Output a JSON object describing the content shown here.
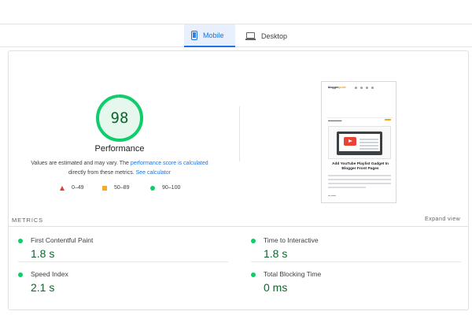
{
  "tabs": [
    {
      "label": "Mobile",
      "active": true,
      "icon": "phone-icon"
    },
    {
      "label": "Desktop",
      "active": false,
      "icon": "desktop-icon"
    }
  ],
  "performance": {
    "score": "98",
    "score_fraction": 0.98,
    "label": "Performance",
    "desc_part1": "Values are estimated and may vary. The ",
    "desc_link1": "performance score is calculated",
    "desc_part2": " directly from these metrics. ",
    "desc_link2": "See calculator"
  },
  "legend": [
    {
      "range": "0–49",
      "shape": "triangle",
      "color": "#e53935"
    },
    {
      "range": "50–89",
      "shape": "square",
      "color": "#f9a825"
    },
    {
      "range": "90–100",
      "shape": "circle",
      "color": "#0cce6b"
    }
  ],
  "screenshot": {
    "site_logo": "bloggerguide",
    "site_logo_accent": "guide",
    "post_title": "Add YouTube Playlist Gadget In Blogger Front Pages"
  },
  "metrics": {
    "title": "METRICS",
    "expand_label": "Expand view",
    "items": [
      {
        "label": "First Contentful Paint",
        "value": "1.8 s"
      },
      {
        "label": "Time to Interactive",
        "value": "1.8 s"
      },
      {
        "label": "Speed Index",
        "value": "2.1 s"
      },
      {
        "label": "Total Blocking Time",
        "value": "0 ms"
      }
    ]
  },
  "colors": {
    "accent_blue": "#1a73e8",
    "good_green": "#0cce6b",
    "good_text": "#0d652d",
    "average_orange": "#f9a825",
    "fail_red": "#e53935"
  }
}
